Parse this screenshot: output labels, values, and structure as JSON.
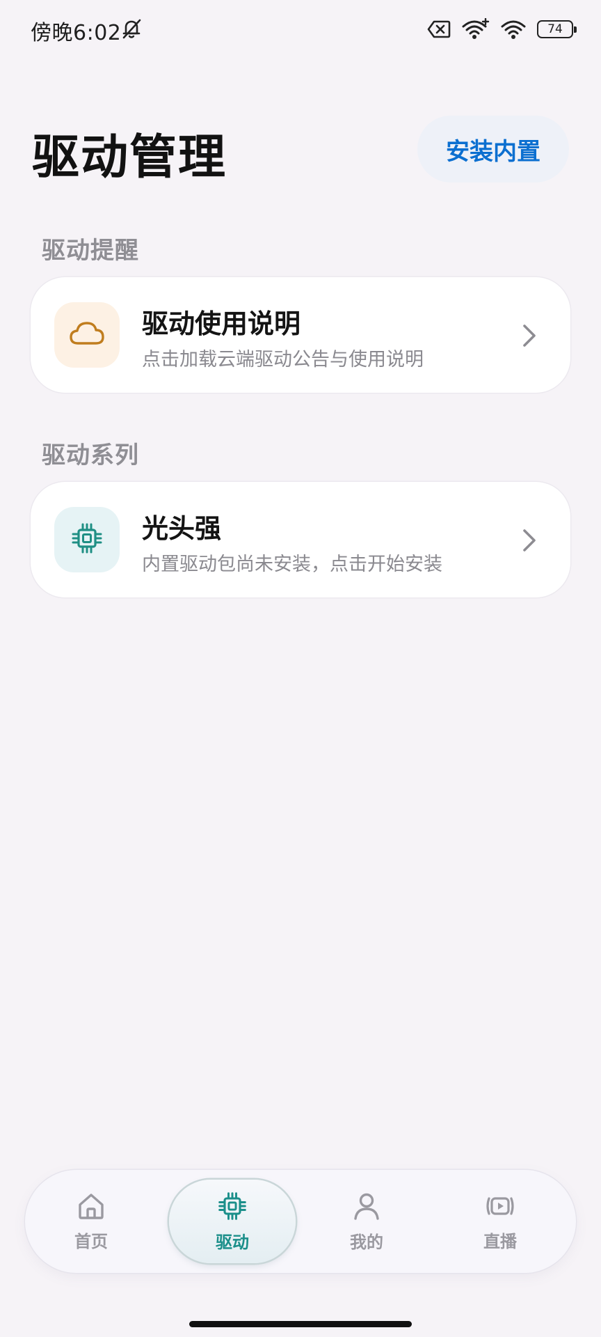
{
  "status_bar": {
    "time": "傍晚6:02",
    "battery": "74",
    "icons": [
      "bell-off-icon",
      "sim-disabled-icon",
      "wifi-plus-icon",
      "wifi-icon",
      "battery-icon"
    ]
  },
  "header": {
    "title": "驱动管理",
    "install_button": "安装内置"
  },
  "sections": [
    {
      "label": "驱动提醒",
      "card": {
        "title": "驱动使用说明",
        "subtitle": "点击加载云端驱动公告与使用说明",
        "icon": "cloud-icon",
        "icon_color": "#c07d1e",
        "icon_bg": "#fdf1e4"
      }
    },
    {
      "label": "驱动系列",
      "card": {
        "title": "光头强",
        "subtitle": "内置驱动包尚未安装，点击开始安装",
        "icon": "chip-icon",
        "icon_color": "#1f8f84",
        "icon_bg": "#e6f3f5"
      }
    }
  ],
  "bottom_nav": {
    "items": [
      {
        "label": "首页",
        "icon": "home-icon",
        "active": false
      },
      {
        "label": "驱动",
        "icon": "chip-icon",
        "active": true
      },
      {
        "label": "我的",
        "icon": "person-icon",
        "active": false
      },
      {
        "label": "直播",
        "icon": "live-play-icon",
        "active": false
      }
    ],
    "active_color": "#1b8f8a",
    "inactive_color": "#9a99a0"
  }
}
